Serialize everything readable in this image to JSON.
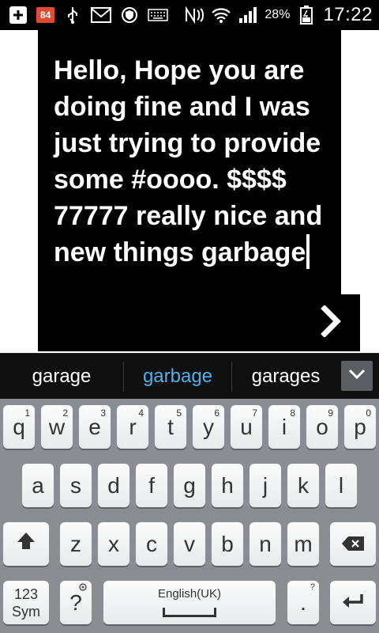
{
  "status_bar": {
    "notification_count": "84",
    "battery_text": "28%",
    "time": "17:22",
    "icons": [
      "add-icon",
      "badge",
      "usb-icon",
      "gmail-icon",
      "shield-icon",
      "keyboard-icon",
      "nfc-icon",
      "wifi-icon",
      "signal-icon",
      "battery-icon"
    ]
  },
  "editor": {
    "text": "Hello, Hope you are doing fine and I was just trying to provide some #oooo. $$$$ 77777 really nice and new things garbage",
    "send_icon": "chevron-right-icon"
  },
  "suggestions": {
    "items": [
      "garage",
      "garbage",
      "garages"
    ],
    "selected_index": 1,
    "expand_icon": "chevron-down-icon"
  },
  "keyboard": {
    "row1": [
      {
        "key": "q",
        "hint": "1"
      },
      {
        "key": "w",
        "hint": "2"
      },
      {
        "key": "e",
        "hint": "3"
      },
      {
        "key": "r",
        "hint": "4"
      },
      {
        "key": "t",
        "hint": "5"
      },
      {
        "key": "y",
        "hint": "6"
      },
      {
        "key": "u",
        "hint": "7"
      },
      {
        "key": "i",
        "hint": "8"
      },
      {
        "key": "o",
        "hint": "9"
      },
      {
        "key": "p",
        "hint": "0"
      }
    ],
    "row2": [
      "a",
      "s",
      "d",
      "f",
      "g",
      "h",
      "j",
      "k",
      "l"
    ],
    "row3": [
      "z",
      "x",
      "c",
      "v",
      "b",
      "n",
      "m"
    ],
    "sym_label_top": "123",
    "sym_label_bottom": "Sym",
    "question_key": "?",
    "space_label": "English(UK)",
    "period_key": ".",
    "period_hint": "?"
  }
}
